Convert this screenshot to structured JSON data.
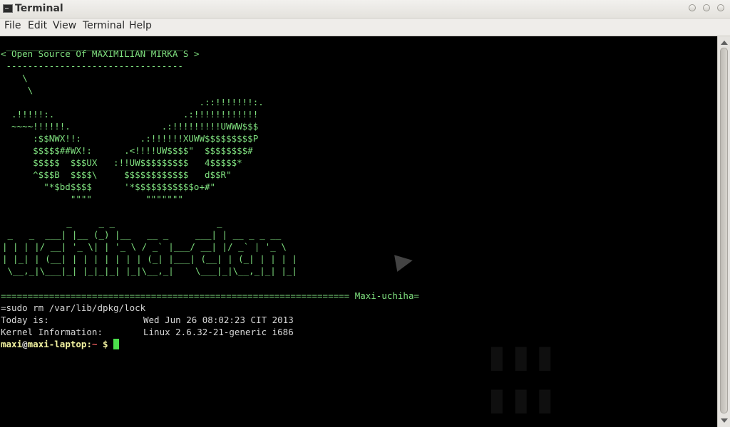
{
  "window": {
    "title": "Terminal",
    "icon": "terminal-icon",
    "buttons": [
      "minimize-icon",
      "maximize-icon",
      "close-icon"
    ]
  },
  "menu": [
    "File",
    "Edit",
    "View",
    "Terminal",
    "Help"
  ],
  "terminal": {
    "cow_bubble": {
      "top": " _________________________________",
      "message": "< Open Source Of MAXIMILIAN MIRKA S >",
      "bottom": " ---------------------------------"
    },
    "ascii_art": [
      "    \\",
      "     \\",
      "                                     .::!!!!!!!:.",
      "  .!!!!!:.                        .:!!!!!!!!!!!!",
      "  ~~~~!!!!!!.                 .:!!!!!!!!!UWWW$$$",
      "      :$$NWX!!:           .:!!!!!!XUWW$$$$$$$$$P",
      "      $$$$$##WX!:      .<!!!!UW$$$$\"  $$$$$$$$#",
      "      $$$$$  $$$UX   :!!UW$$$$$$$$$   4$$$$$*",
      "      ^$$$B  $$$$\\     $$$$$$$$$$$$   d$$R\"",
      "        \"*$bd$$$$      '*$$$$$$$$$$$o+#\"",
      "             \"\"\"\"          \"\"\"\"\"\"\""
    ],
    "banner": [
      "            _     _ _                   _",
      " _   _  ___| |__ (_) |__   __ _     ___| | __ _ _ __",
      "| | | |/ __| '_ \\| | '_ \\ / _` |___/ __| |/ _` | '_ \\",
      "| |_| | (__| | | | | | | | (_| |___| (__| | (_| | | | |",
      " \\__,_|\\___|_| |_|_|_| |_|\\__,_|    \\___|_|\\__,_|_| |_|"
    ],
    "separator": "================================================================= Maxi-uchiha=",
    "command_line": "=sudo rm /var/lib/dpkg/lock",
    "today_label": "Today is:",
    "today_value": "Wed Jun 26 08:02:23 CIT 2013",
    "kernel_label": "Kernel Information:",
    "kernel_value": "Linux 2.6.32-21-generic i686",
    "prompt": {
      "user": "maxi",
      "at": "@",
      "host": "maxi-laptop",
      "colon": ":",
      "path": "~",
      "symbol": "$"
    }
  },
  "colors": {
    "terminal_bg": "#000000",
    "text_green": "#7fe07f",
    "prompt_yellow": "#f2f2a0",
    "path_red": "#e65a5a",
    "cursor_green": "#4be04b"
  }
}
